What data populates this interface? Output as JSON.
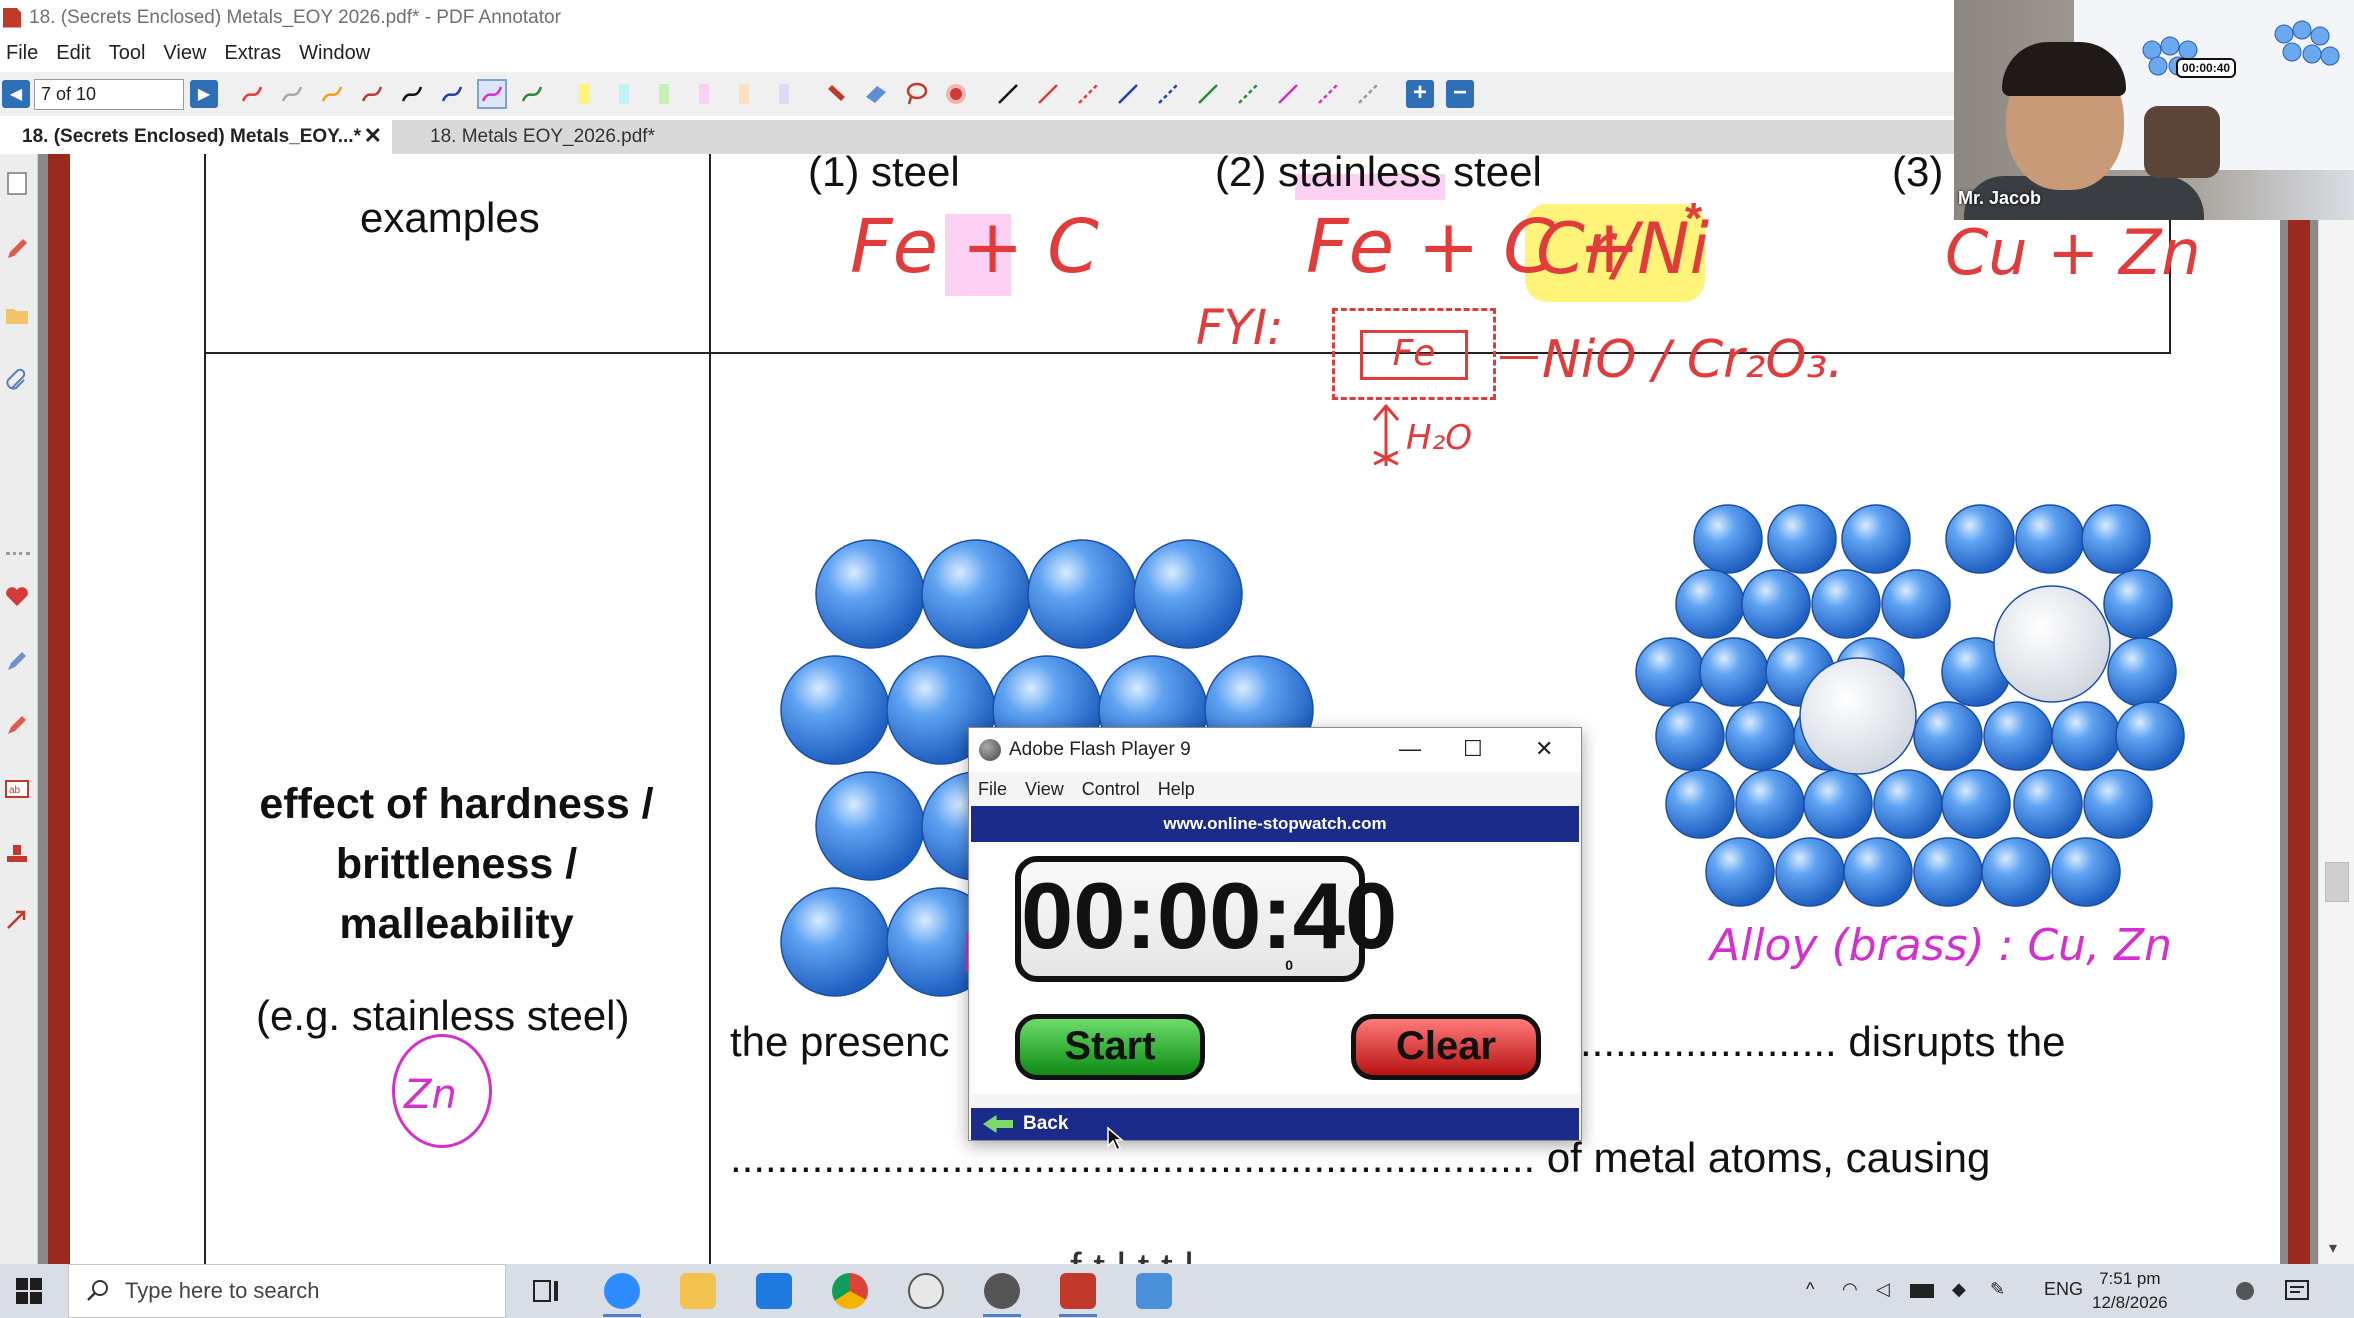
{
  "window": {
    "title": "18. (Secrets Enclosed) Metals_EOY 2026.pdf* - PDF Annotator"
  },
  "menu": [
    "File",
    "Edit",
    "Tool",
    "View",
    "Extras",
    "Window"
  ],
  "toolbar": {
    "page_field": "7 of 10"
  },
  "tabs": [
    {
      "label": "18. (Secrets Enclosed) Metals_EOY...*",
      "close": "✕"
    },
    {
      "label": "18. Metals EOY_2026.pdf*"
    }
  ],
  "document": {
    "row1_header": "examples",
    "example1": "(1) steel",
    "example2": "(2) stainless steel",
    "example3": "(3)",
    "row2_header_lines": [
      "effect of hardness /",
      "brittleness /",
      "malleability"
    ],
    "row2_example": "(e.g. stainless steel)",
    "sentence_start": "the presenc",
    "sentence_mid": "...................... disrupts the",
    "sentence_line2": "..................................................................... of metal atoms, causing",
    "sentence_line3": "f     t l    t     t l"
  },
  "annotations": {
    "steel_formula": "Fe + C",
    "stainless_formula": "Fe + C +",
    "stainless_extra": "Cr/Ni",
    "star": "*",
    "fyi": "FYI:",
    "fe_box": "Fe",
    "oxide": "NiO / Cr₂O₃.",
    "water": "H₂O",
    "brass_formula": "Cu + Zn",
    "alloy_label": "Alloy (brass) : Cu, Zn",
    "circle_note": "Zn"
  },
  "flash_player": {
    "title": "Adobe Flash Player 9",
    "menu": [
      "File",
      "View",
      "Control",
      "Help"
    ],
    "site": "www.online-stopwatch.com",
    "time": "00:00:40",
    "ms": "0",
    "start": "Start",
    "clear": "Clear",
    "back": "Back"
  },
  "webcam": {
    "name": "Mr. Jacob",
    "board_time": "00:00:40"
  },
  "taskbar": {
    "search_placeholder": "Type here to search",
    "language": "ENG",
    "time": "7:51 pm",
    "date": "12/8/2026"
  },
  "colors": {
    "annotation_red": "#e23b3b",
    "annotation_magenta": "#d62fd0",
    "atom_blue": "#3a83e6",
    "flash_blue": "#1a2b8a",
    "highlight_yellow": "#fff37a",
    "highlight_pink": "#fbd0f2"
  }
}
